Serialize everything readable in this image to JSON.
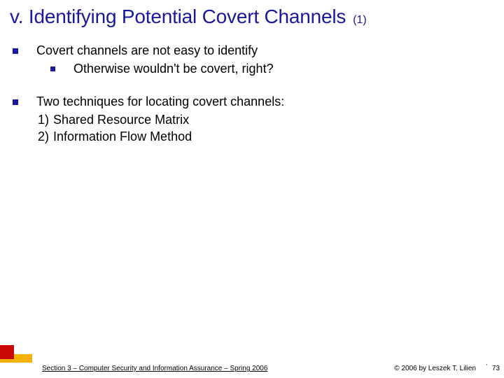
{
  "title": "v. Identifying Potential Covert Channels",
  "title_suffix": "(1)",
  "bullets": {
    "b1": {
      "text": "Covert channels are not easy to identify",
      "sub": "Otherwise wouldn't be covert, right?"
    },
    "b2": {
      "text": "Two techniques for locating covert channels:",
      "items": {
        "i1": {
          "num": "1)",
          "label": "Shared Resource Matrix"
        },
        "i2": {
          "num": "2)",
          "label": "Information Flow Method"
        }
      }
    }
  },
  "footer": {
    "left": "Section 3 – Computer Security and Information Assurance – Spring 2006",
    "right": "© 2006 by Leszek T. Lilien",
    "page": "73",
    "tick": "'"
  }
}
